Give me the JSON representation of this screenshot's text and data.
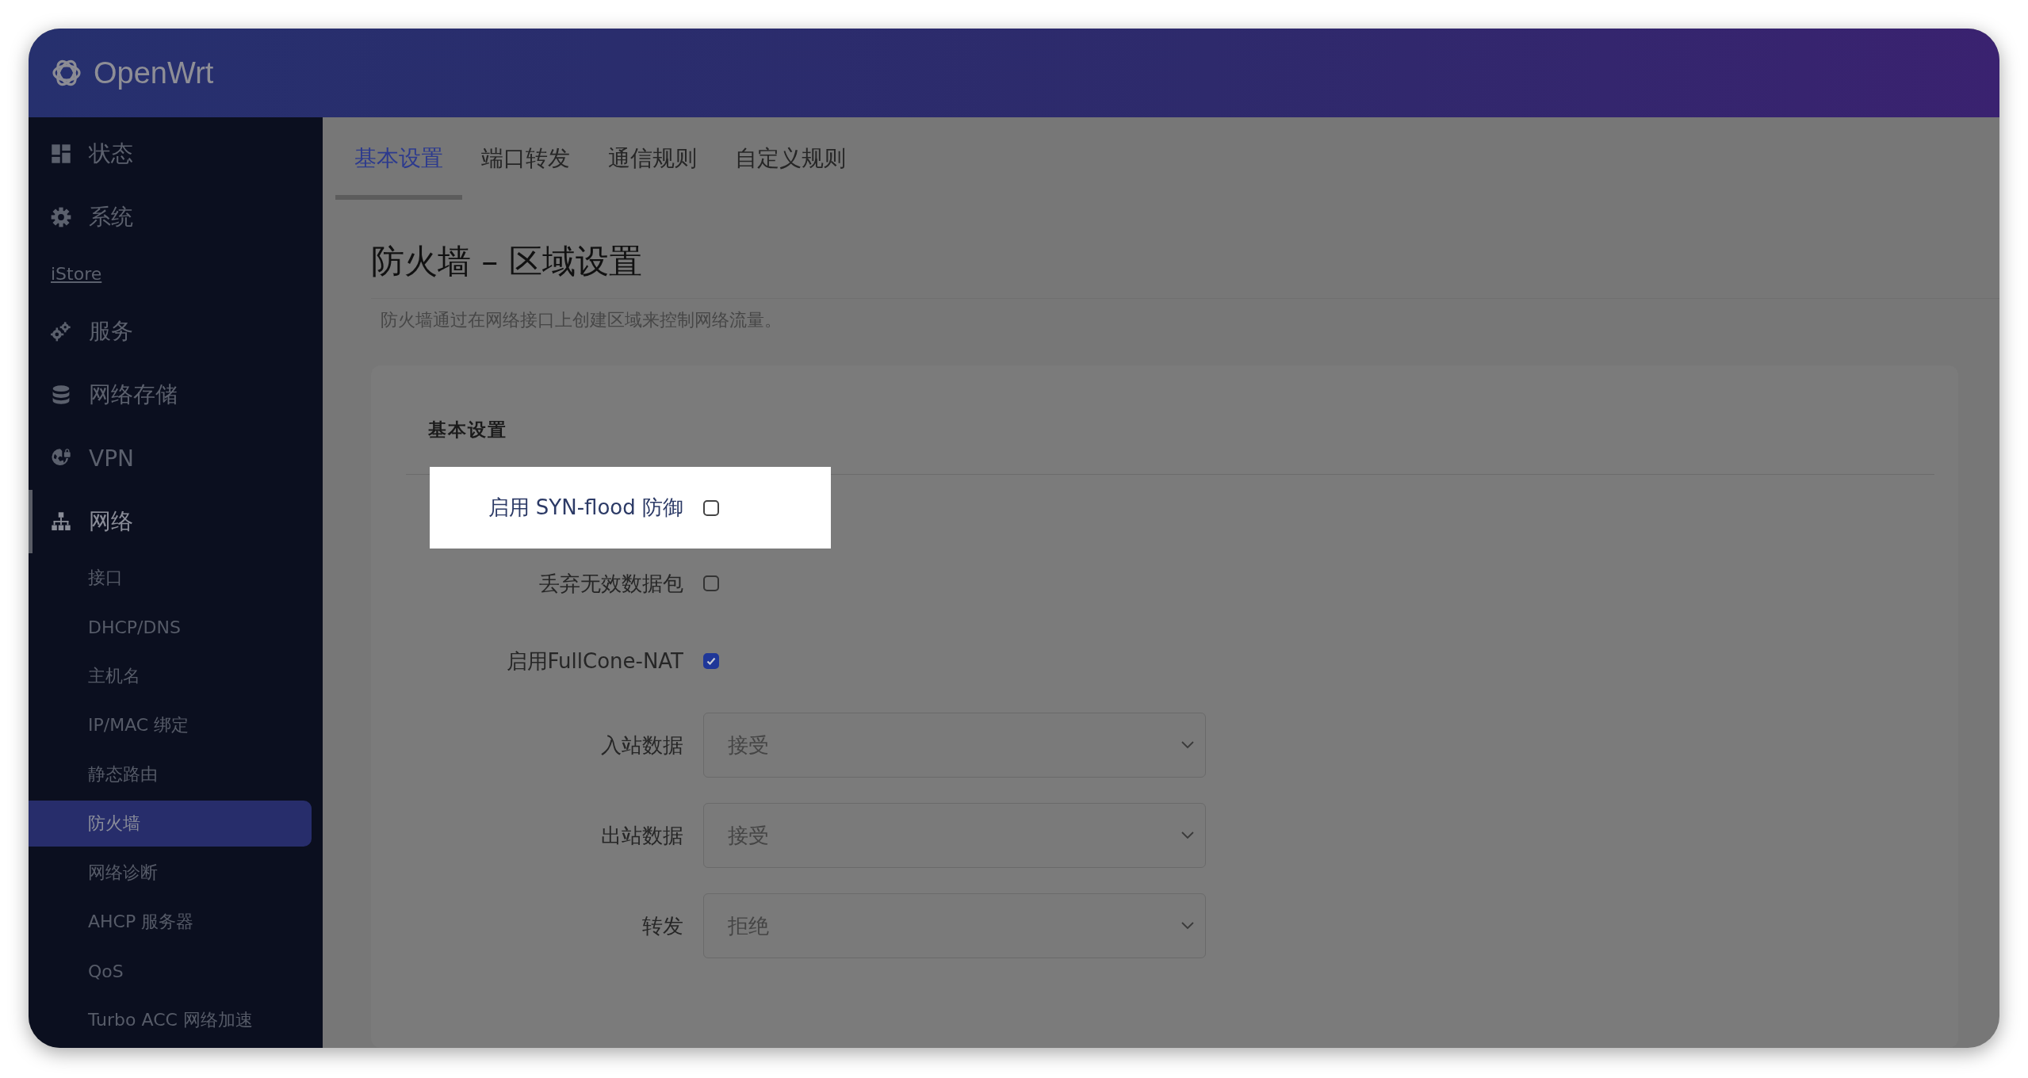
{
  "brand": "OpenWrt",
  "sidebar": {
    "items": [
      {
        "label": "状态",
        "kind": "menu"
      },
      {
        "label": "系统",
        "kind": "menu"
      },
      {
        "label": "iStore",
        "kind": "link"
      },
      {
        "label": "服务",
        "kind": "menu"
      },
      {
        "label": "网络存储",
        "kind": "menu"
      },
      {
        "label": "VPN",
        "kind": "menu"
      },
      {
        "label": "网络",
        "kind": "menu",
        "expanded": true,
        "children": [
          {
            "label": "接口",
            "selected": false
          },
          {
            "label": "DHCP/DNS",
            "selected": false
          },
          {
            "label": "主机名",
            "selected": false
          },
          {
            "label": "IP/MAC 绑定",
            "selected": false
          },
          {
            "label": "静态路由",
            "selected": false
          },
          {
            "label": "防火墙",
            "selected": true
          },
          {
            "label": "网络诊断",
            "selected": false
          },
          {
            "label": "AHCP 服务器",
            "selected": false
          },
          {
            "label": "QoS",
            "selected": false
          },
          {
            "label": "Turbo ACC 网络加速",
            "selected": false
          }
        ]
      }
    ]
  },
  "tabs": [
    {
      "label": "基本设置",
      "selected": true
    },
    {
      "label": "端口转发",
      "selected": false
    },
    {
      "label": "通信规则",
      "selected": false
    },
    {
      "label": "自定义规则",
      "selected": false
    }
  ],
  "title": "防火墙 – 区域设置",
  "description": "防火墙通过在网络接口上创建区域来控制网络流量。",
  "section": {
    "title": "基本设置",
    "fields": [
      {
        "kind": "checkbox",
        "label": "启用 SYN-flood 防御",
        "checked": false,
        "highlighted": true
      },
      {
        "kind": "checkbox",
        "label": "丢弃无效数据包",
        "checked": false,
        "highlighted": false
      },
      {
        "kind": "checkbox",
        "label": "启用FullCone-NAT",
        "checked": true,
        "highlighted": false
      },
      {
        "kind": "select",
        "label": "入站数据",
        "value": "接受",
        "highlighted": false
      },
      {
        "kind": "select",
        "label": "出站数据",
        "value": "接受",
        "highlighted": false
      },
      {
        "kind": "select",
        "label": "转发",
        "value": "拒绝",
        "highlighted": false
      }
    ]
  }
}
